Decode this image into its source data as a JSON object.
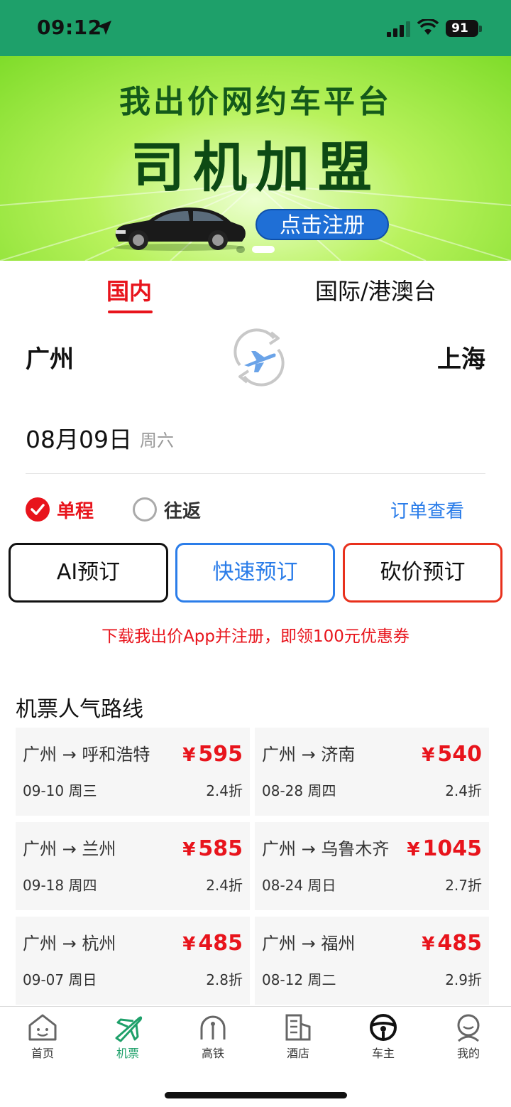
{
  "status_bar": {
    "time": "09:12",
    "battery": "91"
  },
  "banner": {
    "title_line1": "我出价网约车平台",
    "title_line2": "司机加盟",
    "cta": "点击注册"
  },
  "tabs": [
    {
      "label": "国内"
    },
    {
      "label": "国际/港澳台"
    }
  ],
  "route": {
    "from": "广州",
    "to": "上海"
  },
  "date": {
    "main": "08月09日",
    "weekday": "周六"
  },
  "trip_type": {
    "one_way": "单程",
    "round_trip": "往返",
    "order_link": "订单查看"
  },
  "buttons": {
    "ai": "AI预订",
    "fast": "快速预订",
    "bargain": "砍价预订"
  },
  "promo": "下载我出价App并注册，即领100元优惠券",
  "section_title": "机票人气路线",
  "routes": [
    {
      "name": "广州 → 呼和浩特",
      "yen": "¥",
      "price": "595",
      "date": "09-10 周三",
      "discount": "2.4折"
    },
    {
      "name": "广州 → 济南",
      "yen": "¥",
      "price": "540",
      "date": "08-28 周四",
      "discount": "2.4折"
    },
    {
      "name": "广州 → 兰州",
      "yen": "¥",
      "price": "585",
      "date": "09-18 周四",
      "discount": "2.4折"
    },
    {
      "name": "广州 → 乌鲁木齐",
      "yen": "¥",
      "price": "1045",
      "date": "08-24 周日",
      "discount": "2.7折"
    },
    {
      "name": "广州 → 杭州",
      "yen": "¥",
      "price": "485",
      "date": "09-07 周日",
      "discount": "2.8折"
    },
    {
      "name": "广州 → 福州",
      "yen": "¥",
      "price": "485",
      "date": "08-12 周二",
      "discount": "2.9折"
    }
  ],
  "nav": [
    {
      "label": "首页",
      "icon": "home-icon"
    },
    {
      "label": "机票",
      "icon": "plane-icon"
    },
    {
      "label": "高铁",
      "icon": "train-icon"
    },
    {
      "label": "酒店",
      "icon": "hotel-icon"
    },
    {
      "label": "车主",
      "icon": "steering-wheel-icon"
    },
    {
      "label": "我的",
      "icon": "profile-icon"
    }
  ],
  "colors": {
    "brand_green": "#1ea06a",
    "accent_red": "#e8141c",
    "link_blue": "#2b7de9"
  }
}
